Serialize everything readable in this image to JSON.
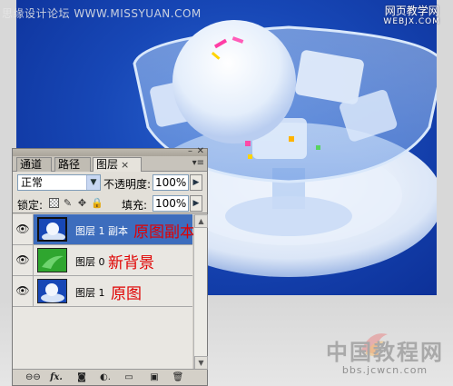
{
  "watermarks": {
    "top_left": "思缘设计论坛 WWW.MISSYUAN.COM",
    "top_right_main": "网页教学网",
    "top_right_sub": "WEBJX.COM",
    "bottom_right_main": "中国教程网",
    "bottom_right_sub": "bbs.jcwcn.com"
  },
  "panel": {
    "minimize": "–",
    "close": "✕",
    "menu": "▾≡",
    "tabs": [
      {
        "label": "通道"
      },
      {
        "label": "路径"
      },
      {
        "label": "图层",
        "active": true
      }
    ],
    "tab_close": "×",
    "blend_mode": "正常",
    "blend_arrow": "▼",
    "opacity_label": "不透明度:",
    "opacity_value": "100%",
    "arrow": "▶",
    "lock_label": "锁定:",
    "lock_icons": [
      "transparency-lock-icon",
      "brush-lock-icon",
      "move-lock-icon",
      "lock-icon"
    ],
    "lock_brush_glyph": "✎",
    "lock_move_glyph": "✥",
    "lock_all_glyph": "🔒",
    "fill_label": "填充:",
    "fill_value": "100%",
    "eye_glyph": "👁",
    "layers": [
      {
        "name": "图层 1 副本",
        "note": "原图副本",
        "selected": true,
        "thumb": "blue"
      },
      {
        "name": "图层 0",
        "note": "新背景",
        "selected": false,
        "thumb": "green"
      },
      {
        "name": "图层 1",
        "note": "原图",
        "selected": false,
        "thumb": "blue"
      }
    ],
    "scroll_up": "▲",
    "scroll_down": "▼",
    "footer": {
      "link": "⊖⊖",
      "fx": "fx.",
      "mask": "◙",
      "adjust": "◐.",
      "group": "▭",
      "new": "▣",
      "trash": "🗑"
    }
  },
  "colors": {
    "photo_bg": "#1747b6",
    "selected_row": "#3d6dbd",
    "note_red": "#e00000",
    "green_layer": "#2fa62f"
  }
}
